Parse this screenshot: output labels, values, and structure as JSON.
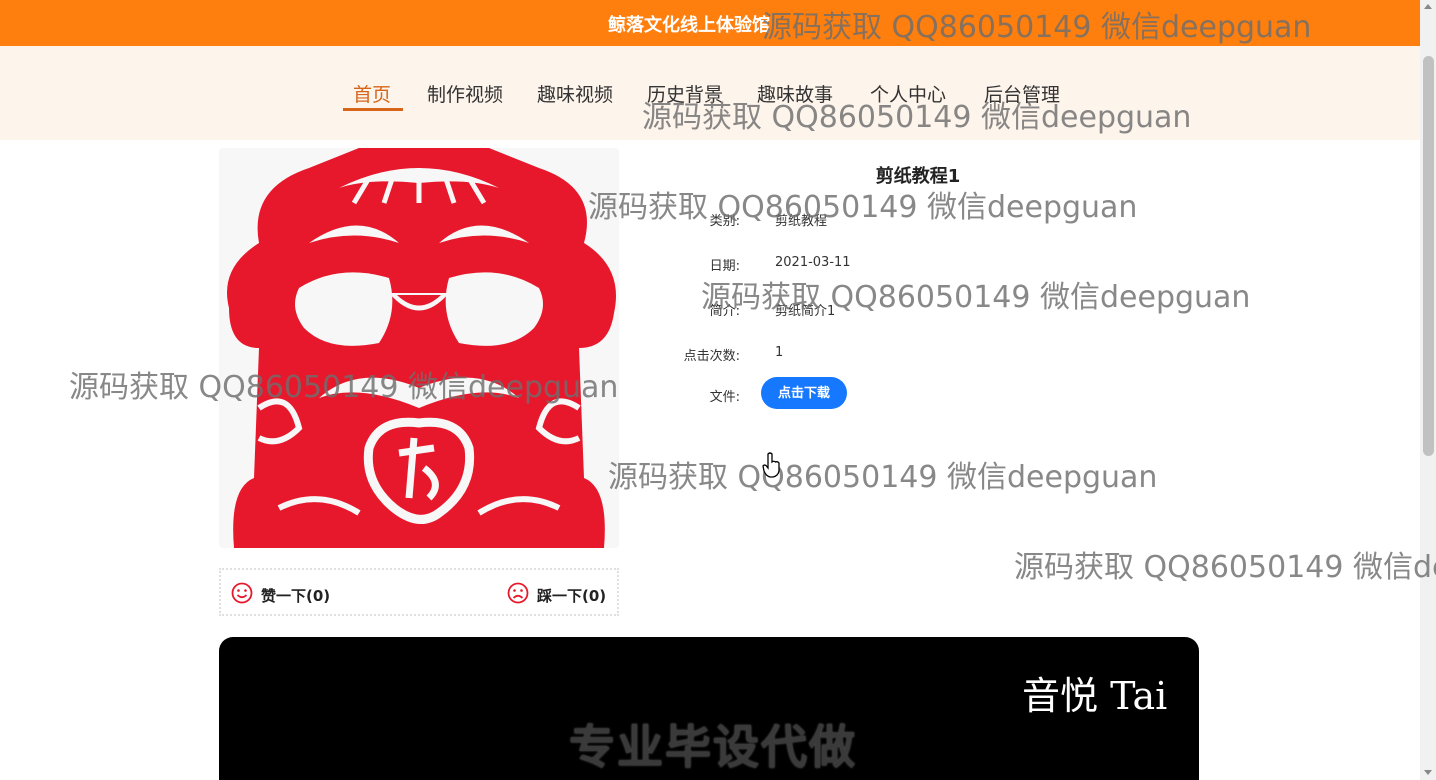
{
  "header": {
    "site_title": "鲸落文化线上体验馆"
  },
  "nav": {
    "items": [
      {
        "label": "首页",
        "active": true
      },
      {
        "label": "制作视频"
      },
      {
        "label": "趣味视频"
      },
      {
        "label": "历史背景"
      },
      {
        "label": "趣味故事"
      },
      {
        "label": "个人中心"
      },
      {
        "label": "后台管理"
      }
    ]
  },
  "detail": {
    "title": "剪纸教程1",
    "fields": [
      {
        "label": "类别:",
        "value": "剪纸教程"
      },
      {
        "label": "日期:",
        "value": "2021-03-11"
      },
      {
        "label": "简介:",
        "value": "剪纸简介1"
      },
      {
        "label": "点击次数:",
        "value": "1"
      }
    ],
    "file_label": "文件:",
    "download_label": "点击下载"
  },
  "votes": {
    "like_label": "赞一下(0)",
    "dislike_label": "踩一下(0)"
  },
  "video": {
    "logo_text": "音悦 Tai",
    "caption": "专业毕设代做"
  },
  "watermark_text": "源码获取 QQ86050149 微信deepguan",
  "colors": {
    "topbar": "#ff7f0e",
    "accent": "#d6651a",
    "button": "#1677ff",
    "papercut": "#e8182c"
  }
}
